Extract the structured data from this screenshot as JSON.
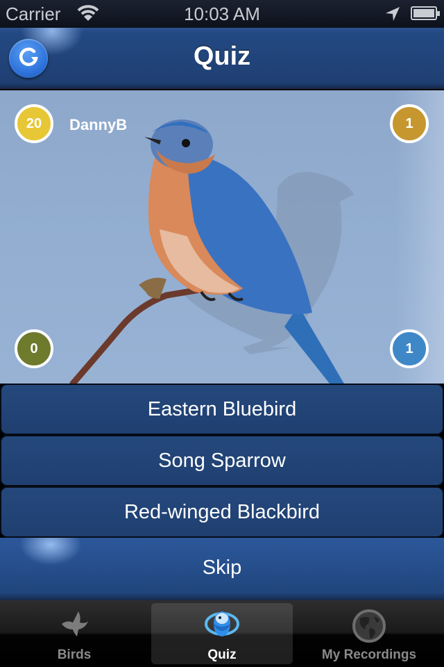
{
  "status_bar": {
    "carrier": "Carrier",
    "time": "10:03 AM",
    "wifi_icon": "wifi-icon",
    "location_icon": "location-arrow-icon",
    "battery_icon": "battery-full-icon"
  },
  "nav": {
    "title": "Quiz",
    "refresh_icon": "refresh-icon"
  },
  "quiz": {
    "username": "DannyB",
    "badges": {
      "score": "20",
      "gold": "1",
      "wrong": "0",
      "right": "1"
    },
    "image_subject": "Eastern Bluebird perched on branch",
    "answers": [
      {
        "label": "Eastern Bluebird"
      },
      {
        "label": "Song Sparrow"
      },
      {
        "label": "Red-winged Blackbird"
      }
    ],
    "skip_label": "Skip"
  },
  "colors": {
    "nav_blue": "#234983",
    "answer_blue": "#25487c",
    "badge_score": "#e8c736",
    "badge_gold": "#c6972f",
    "badge_wrong": "#6e7a2c",
    "badge_right": "#3f88c7"
  },
  "tab_bar": {
    "tabs": [
      {
        "label": "Birds",
        "icon": "bird-icon",
        "active": false
      },
      {
        "label": "Quiz",
        "icon": "quiz-eye-icon",
        "active": true
      },
      {
        "label": "My Recordings",
        "icon": "globe-icon",
        "active": false
      }
    ]
  }
}
